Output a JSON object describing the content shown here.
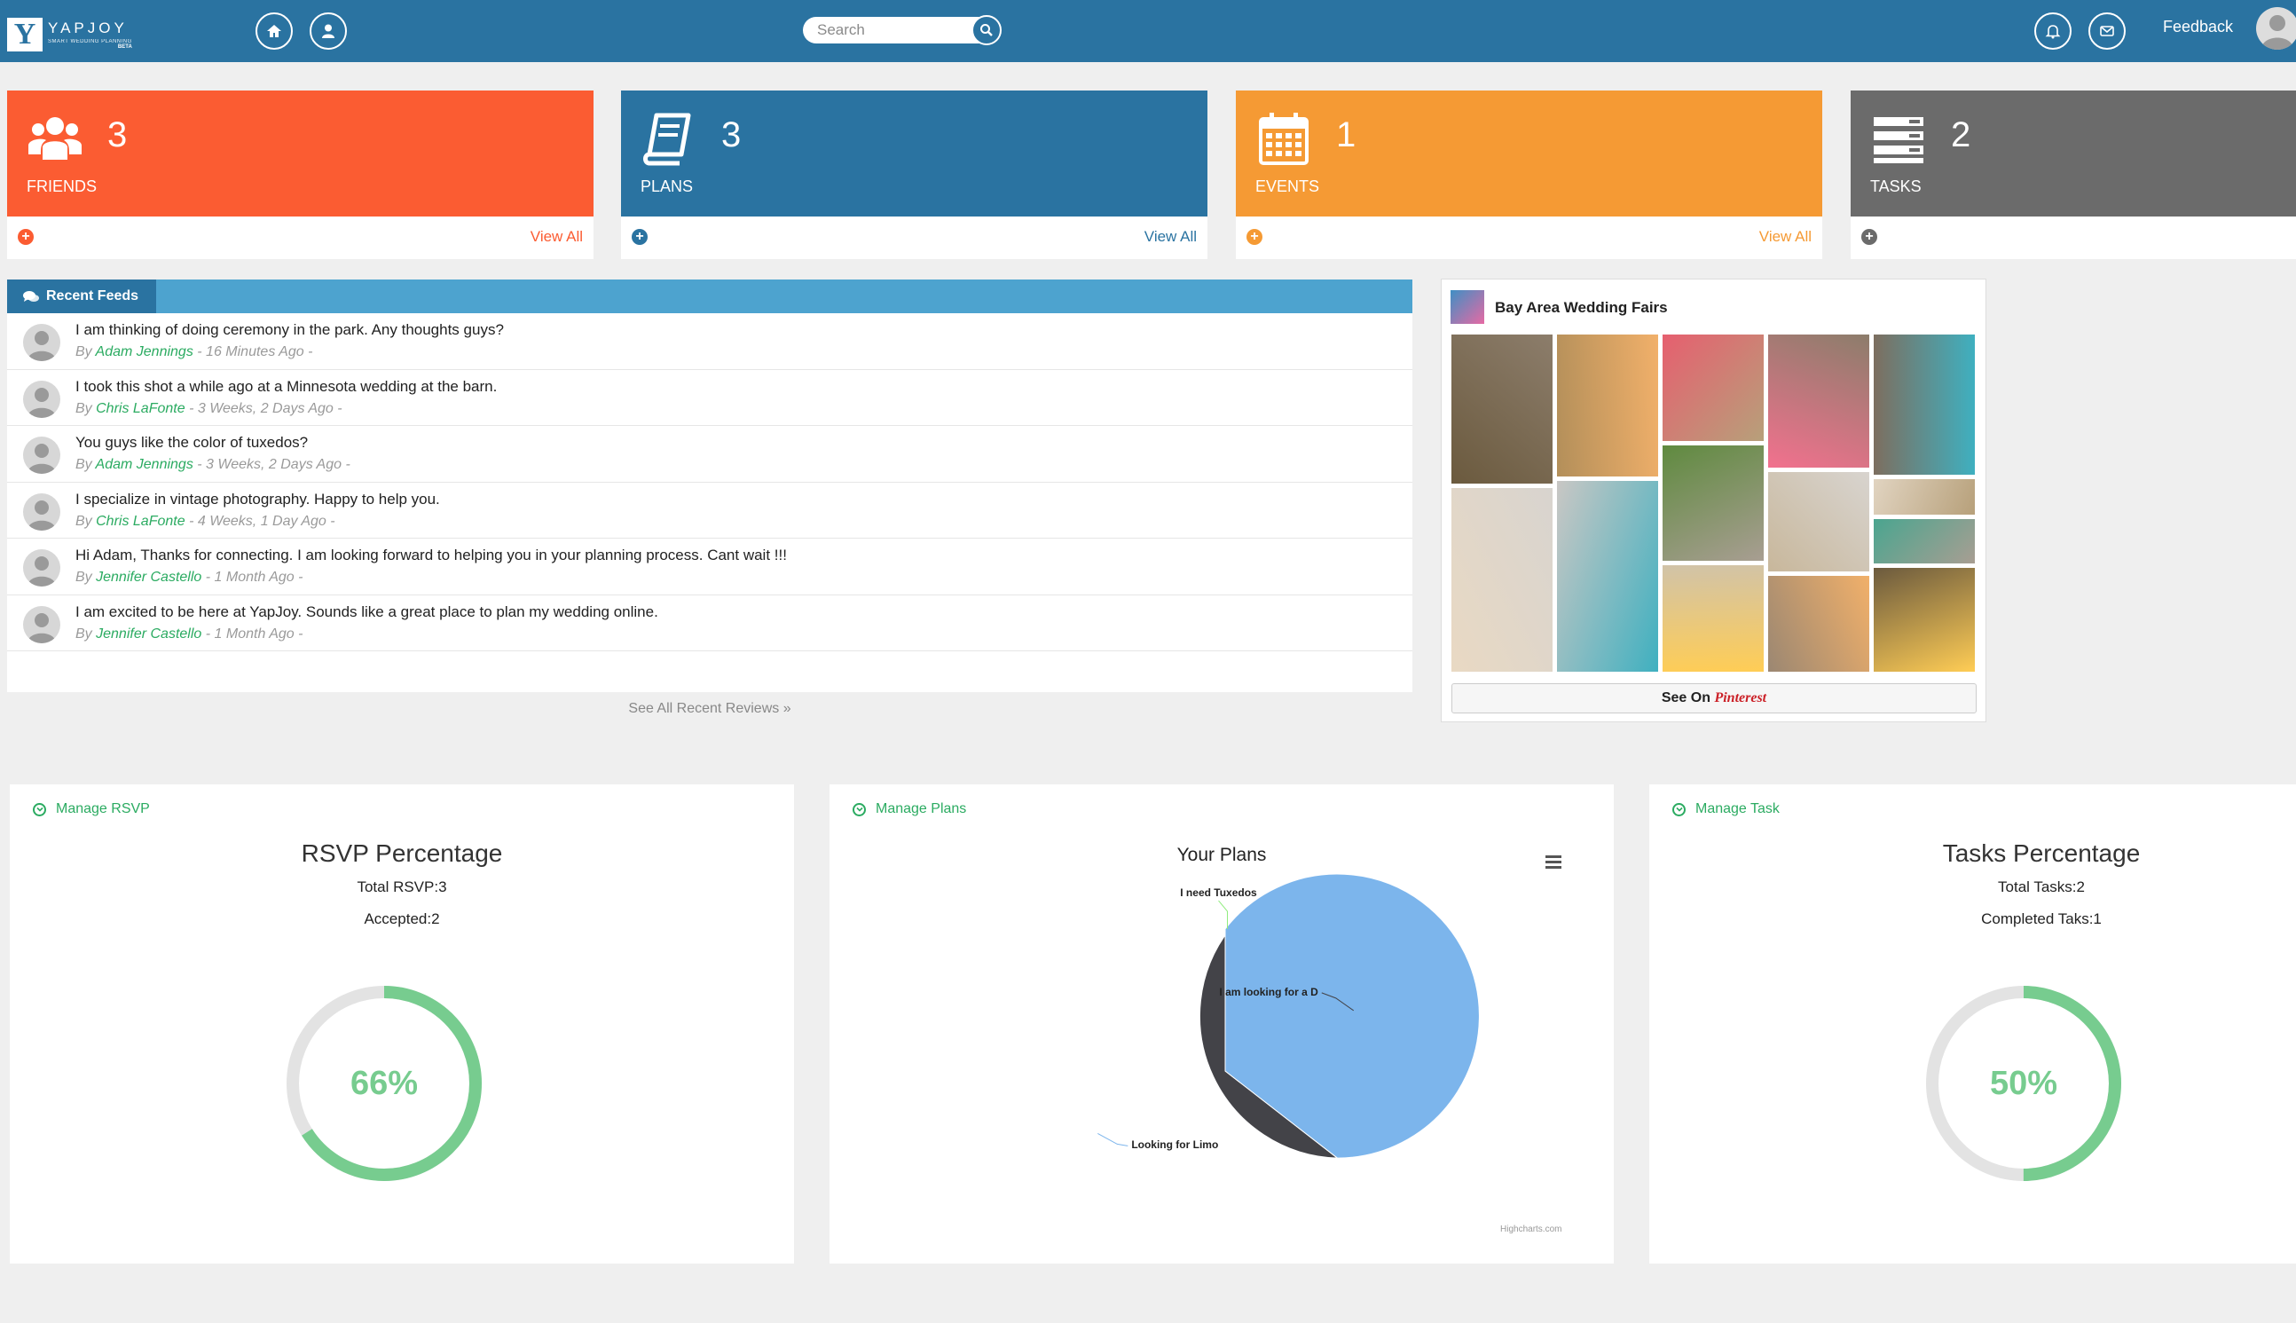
{
  "topbar": {
    "logo_name": "YAPJOY",
    "logo_sub": "SMART WEDDING PLANNING",
    "logo_beta": "BETA",
    "search_placeholder": "Search",
    "feedback": "Feedback",
    "icons": [
      "home-icon",
      "user-icon",
      "search-icon",
      "bell-icon",
      "mail-icon"
    ]
  },
  "stats": [
    {
      "count": "3",
      "label": "FRIENDS",
      "view": "View All",
      "color": "#fb5c32",
      "icon": "users-icon"
    },
    {
      "count": "3",
      "label": "PLANS",
      "view": "View All",
      "color": "#2a73a1",
      "icon": "book-icon"
    },
    {
      "count": "1",
      "label": "EVENTS",
      "view": "View All",
      "color": "#f59a34",
      "icon": "calendar-icon"
    },
    {
      "count": "2",
      "label": "TASKS",
      "view": "",
      "color": "#6b6b6b",
      "icon": "list-icon"
    }
  ],
  "feeds": {
    "tab": "Recent Feeds",
    "by": "By",
    "items": [
      {
        "text": "I am thinking of doing ceremony in the park. Any thoughts guys?",
        "author": "Adam Jennings",
        "time": "- 16 Minutes Ago -"
      },
      {
        "text": "I took this shot a while ago at a Minnesota wedding at the barn.",
        "author": "Chris LaFonte",
        "time": "- 3 Weeks, 2 Days Ago -"
      },
      {
        "text": "You guys like the color of tuxedos?",
        "author": "Adam Jennings",
        "time": "- 3 Weeks, 2 Days Ago -"
      },
      {
        "text": "I specialize in vintage photography. Happy to help you.",
        "author": "Chris LaFonte",
        "time": "- 4 Weeks, 1 Day Ago -"
      },
      {
        "text": "Hi Adam, Thanks for connecting. I am looking forward to helping you in your planning process. Cant wait !!!",
        "author": "Jennifer Castello",
        "time": "- 1 Month Ago -"
      },
      {
        "text": "I am excited to be here at YapJoy. Sounds like a great place to plan my wedding online.",
        "author": "Jennifer Castello",
        "time": "- 1 Month Ago -"
      }
    ],
    "footer": "See All Recent Reviews »"
  },
  "pinterest": {
    "title": "Bay Area Wedding Fairs",
    "button_prefix": "See On",
    "button_brand": "Pinterest",
    "photo_colors": [
      "#6b5a3e",
      "#e9d9c3",
      "#b38f5a",
      "#c9c7c4",
      "#e65f6f",
      "#5f8a3f",
      "#d1c3a8",
      "#8c7d6b",
      "#d8d4cf",
      "#f1b06a",
      "#3fb0c0",
      "#b7a07a",
      "#a89e92",
      "#ffcd55",
      "#f2718e",
      "#c8b79b",
      "#9b8772",
      "#7d6e5f",
      "#e1d4c1",
      "#4aa58f"
    ]
  },
  "rsvp": {
    "link": "Manage RSVP",
    "title": "RSVP Percentage",
    "total": "Total RSVP:3",
    "accepted": "Accepted:2",
    "percent_label": "66%",
    "percent": 66
  },
  "plans": {
    "link": "Manage Plans",
    "credits": "Highcharts.com"
  },
  "tasks": {
    "link": "Manage Task",
    "title": "Tasks Percentage",
    "total": "Total Tasks:2",
    "completed": "Completed Taks:1",
    "percent_label": "50%",
    "percent": 50
  },
  "chart_data": {
    "type": "pie",
    "title": "Your Plans",
    "categories": [
      "I need Tuxedos",
      "I am looking for a D",
      "Looking for Limo"
    ],
    "values": [
      0.5,
      35,
      64.5
    ],
    "colors": [
      "#90ed7d",
      "#434348",
      "#7cb5ec"
    ]
  }
}
